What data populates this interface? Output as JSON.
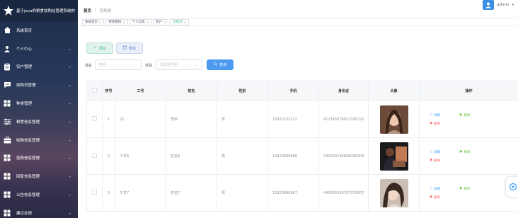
{
  "app": {
    "title": "基于java的粮食收购站管理系统的"
  },
  "sidebar": {
    "items": [
      {
        "label": "系统首页",
        "icon": "home-icon",
        "expandable": false
      },
      {
        "label": "个人中心",
        "icon": "user-icon",
        "expandable": true
      },
      {
        "label": "农户管理",
        "icon": "clipboard-icon",
        "expandable": true
      },
      {
        "label": "收购员管理",
        "icon": "chat-icon",
        "expandable": true
      },
      {
        "label": "种类管理",
        "icon": "grid-icon",
        "expandable": true
      },
      {
        "label": "粮食信息管理",
        "icon": "sliders-icon",
        "expandable": true
      },
      {
        "label": "收购信息管理",
        "icon": "briefcase-icon",
        "expandable": true
      },
      {
        "label": "查购信息管理",
        "icon": "grid-icon",
        "expandable": true
      },
      {
        "label": "回复信息管理",
        "icon": "grid-icon",
        "expandable": true
      },
      {
        "label": "公告信息管理",
        "icon": "grid-icon",
        "expandable": true
      },
      {
        "label": "建议反馈",
        "icon": "grid-icon",
        "expandable": true
      }
    ]
  },
  "header": {
    "breadcrumb": [
      "首页",
      "农购员"
    ],
    "user": "admin"
  },
  "tags": [
    {
      "label": "系统首页",
      "active": false
    },
    {
      "label": "修改密码",
      "active": false
    },
    {
      "label": "个人信息",
      "active": false
    },
    {
      "label": "农户",
      "active": false
    },
    {
      "label": "农购员",
      "active": true
    }
  ],
  "toolbar": {
    "add_label": "添加",
    "delete_label": "删除"
  },
  "filters": {
    "name_label": "姓名",
    "name_placeholder": "姓名",
    "gender_label": "性别",
    "gender_placeholder": "请选择性别",
    "search_label": "查询"
  },
  "table": {
    "columns": [
      "",
      "序号",
      "工号",
      "姓名",
      "性别",
      "手机",
      "身份证",
      "头像",
      "操作"
    ],
    "rows": [
      {
        "index": "1",
        "job_no": "22",
        "name": "李四",
        "gender": "男",
        "phone": "13922222222",
        "id_card": "412345678912345222",
        "photo": "portrait-1"
      },
      {
        "index": "2",
        "job_no": "工号8",
        "name": "姓名8",
        "gender": "男",
        "phone": "13823888888",
        "id_card": "440300199808080008",
        "photo": "portrait-2"
      },
      {
        "index": "3",
        "job_no": "工号7",
        "name": "姓名7",
        "gender": "男",
        "phone": "13823888887",
        "id_card": "440300199707070007",
        "photo": "portrait-3"
      }
    ],
    "actions": {
      "view": "详情",
      "edit": "修改",
      "delete": "删除"
    }
  },
  "colors": {
    "accent": "#42b983",
    "link": "#409eff",
    "search": "#4d9bf0",
    "danger": "#f56c6c",
    "success": "#67c23a"
  }
}
